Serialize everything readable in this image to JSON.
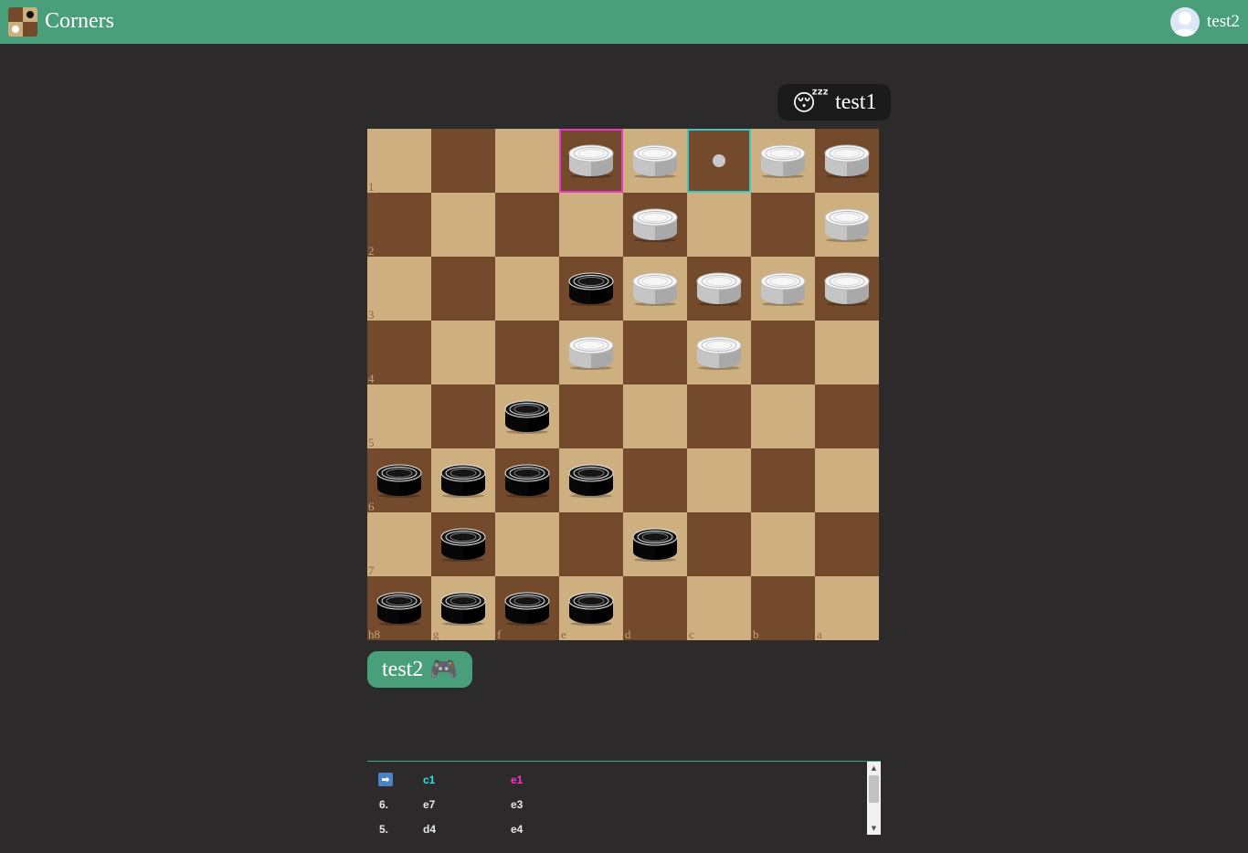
{
  "header": {
    "title": "Corners",
    "user": "test2",
    "colors": {
      "bar": "#4a9f7b"
    }
  },
  "opponent": {
    "name": "test1",
    "status_emoji": "😴"
  },
  "player": {
    "name": "test2",
    "status_emoji": "🎮"
  },
  "board": {
    "colors": {
      "light": "#ceaf80",
      "dark": "#734a2c",
      "last_from": "#e73cc0",
      "last_to": "#3dc6c2"
    },
    "row_labels": [
      "1",
      "2",
      "3",
      "4",
      "5",
      "6",
      "7",
      "h8"
    ],
    "col_labels": [
      "g",
      "f",
      "e",
      "d",
      "c",
      "b",
      "a"
    ],
    "last_move": {
      "from": "e1",
      "to": "c1"
    },
    "pieces": [
      {
        "square": "e1",
        "color": "white"
      },
      {
        "square": "d1",
        "color": "white"
      },
      {
        "square": "b1",
        "color": "white"
      },
      {
        "square": "a1",
        "color": "white"
      },
      {
        "square": "d2",
        "color": "white"
      },
      {
        "square": "a2",
        "color": "white"
      },
      {
        "square": "e3",
        "color": "black"
      },
      {
        "square": "d3",
        "color": "white"
      },
      {
        "square": "c3",
        "color": "white"
      },
      {
        "square": "b3",
        "color": "white"
      },
      {
        "square": "a3",
        "color": "white"
      },
      {
        "square": "e4",
        "color": "white"
      },
      {
        "square": "c4",
        "color": "white"
      },
      {
        "square": "f5",
        "color": "black"
      },
      {
        "square": "h6",
        "color": "black"
      },
      {
        "square": "g6",
        "color": "black"
      },
      {
        "square": "f6",
        "color": "black"
      },
      {
        "square": "e6",
        "color": "black"
      },
      {
        "square": "g7",
        "color": "black"
      },
      {
        "square": "d7",
        "color": "black"
      },
      {
        "square": "h8",
        "color": "black"
      },
      {
        "square": "g8",
        "color": "black"
      },
      {
        "square": "f8",
        "color": "black"
      },
      {
        "square": "e8",
        "color": "black"
      }
    ]
  },
  "moves": {
    "current_icon": "➡",
    "rows": [
      {
        "num": "",
        "white": "c1",
        "black": "e1",
        "current": true
      },
      {
        "num": "6.",
        "white": "e7",
        "black": "e3"
      },
      {
        "num": "5.",
        "white": "d4",
        "black": "e4"
      }
    ],
    "colors": {
      "white_current": "#2ee3e8",
      "black_current": "#ff33cc"
    }
  }
}
